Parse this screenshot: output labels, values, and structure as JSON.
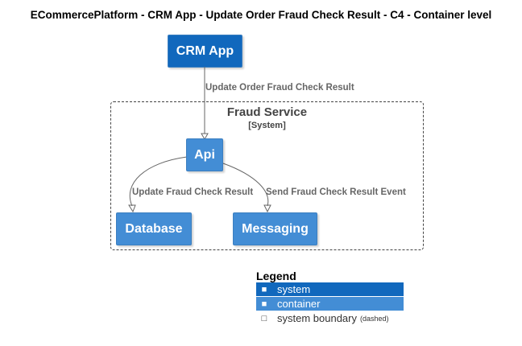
{
  "title": "ECommercePlatform - CRM App - Update Order Fraud Check Result - C4 - Container level",
  "nodes": {
    "crm_app": "CRM App",
    "api": "Api",
    "database": "Database",
    "messaging": "Messaging"
  },
  "boundary": {
    "name": "Fraud Service",
    "type": "[System]"
  },
  "relations": {
    "crm_to_api": "Update Order Fraud Check Result",
    "api_to_database": "Update Fraud Check Result",
    "api_to_messaging": "Send Fraud Check Result Event"
  },
  "legend": {
    "title": "Legend",
    "system": "system",
    "container": "container",
    "boundary": "system boundary",
    "boundary_note": "(dashed)"
  },
  "colors": {
    "system": "#1168bd",
    "container": "#438dd5",
    "boundary_line": "#444444"
  }
}
